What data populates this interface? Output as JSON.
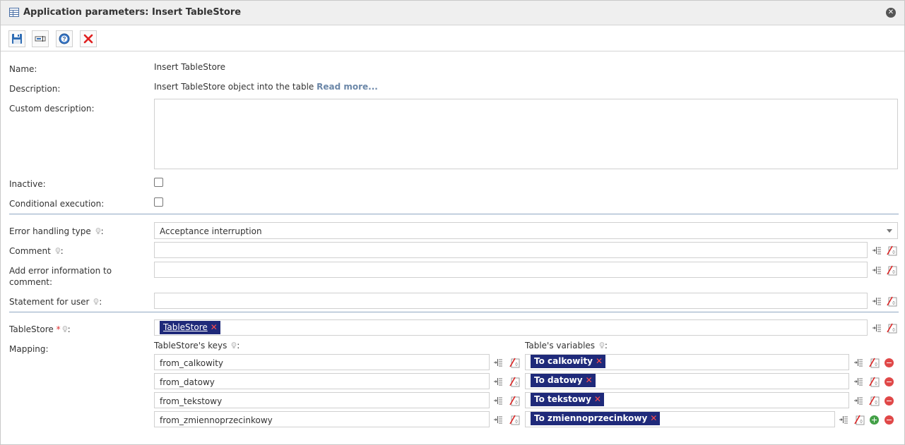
{
  "window": {
    "title": "Application parameters: Insert TableStore",
    "title_icon": "table-icon",
    "close_icon": "close-icon"
  },
  "toolbar": {
    "buttons": [
      {
        "name": "save-button",
        "icon": "floppy-disk-icon"
      },
      {
        "name": "rename-button",
        "icon": "text-field-icon"
      },
      {
        "name": "help-button",
        "icon": "help-icon"
      },
      {
        "name": "delete-button",
        "icon": "red-x-icon"
      }
    ]
  },
  "form": {
    "name": {
      "label": "Name:",
      "value": "Insert TableStore"
    },
    "description": {
      "label": "Description:",
      "value": "Insert TableStore object into the table",
      "link": "Read more..."
    },
    "custom_description": {
      "label": "Custom description:",
      "value": ""
    },
    "inactive": {
      "label": "Inactive:",
      "checked": false
    },
    "conditional_execution": {
      "label": "Conditional execution:",
      "checked": false
    },
    "error_handling_type": {
      "label": "Error handling type",
      "value": "Acceptance interruption"
    },
    "comment": {
      "label": "Comment",
      "value": ""
    },
    "add_error_info": {
      "label_line1": "Add error information to",
      "label_line2": "comment:",
      "value": ""
    },
    "statement_for_user": {
      "label": "Statement for user",
      "value": ""
    },
    "tablestore": {
      "label": "TableStore",
      "required_mark": "*",
      "tag": "TableStore"
    },
    "mapping": {
      "label": "Mapping:",
      "keys_header": "TableStore's keys",
      "vars_header": "Table's variables",
      "rows": [
        {
          "key": "from_calkowity",
          "var": "To calkowity"
        },
        {
          "key": "from_datowy",
          "var": "To datowy"
        },
        {
          "key": "from_tekstowy",
          "var": "To tekstowy"
        },
        {
          "key": "from_zmiennoprzecinkowy",
          "var": "To zmiennoprzecinkowy"
        }
      ]
    }
  },
  "glyphs": {
    "colon": ":",
    "tag_remove": "✕",
    "close": "✕"
  }
}
